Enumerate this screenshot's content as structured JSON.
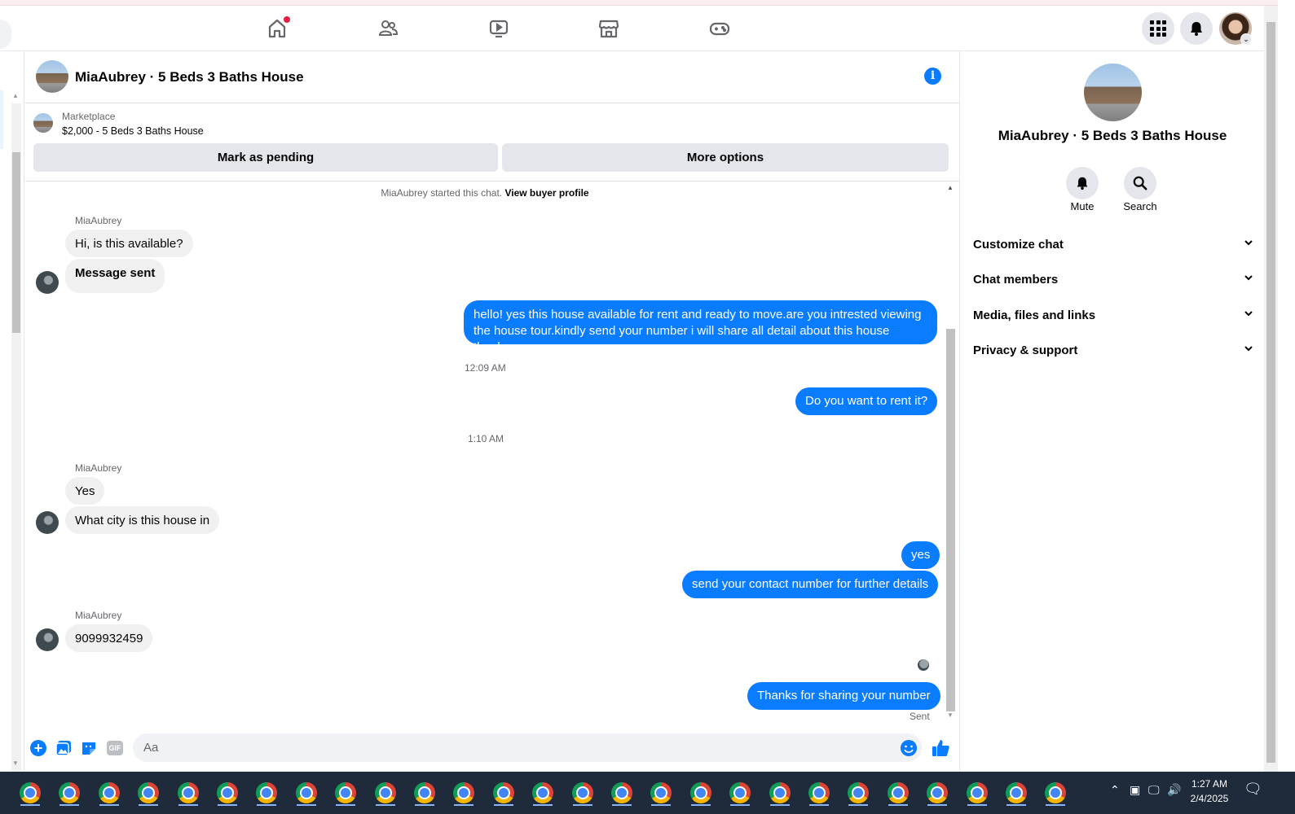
{
  "chat": {
    "title": "MiaAubrey · 5 Beds 3 Baths House"
  },
  "marketplace": {
    "label": "Marketplace",
    "listing": "$2,000 - 5 Beds 3 Baths House",
    "mark_pending": "Mark as pending",
    "more_options": "More options"
  },
  "messages": {
    "started_prefix": "MiaAubrey started this chat. ",
    "view_profile": "View buyer profile",
    "sender": "MiaAubrey",
    "in1": "Hi, is this available?",
    "in2": "Message sent",
    "out1_line1": "hello! yes this house available for rent and ready to move.are you intrested viewing",
    "out1_line2": "the house tour.kindly send your number i will share all detail about this house thanks.",
    "ts1": "12:09 AM",
    "out2": "Do you want to rent it?",
    "ts2": "1:10 AM",
    "in3": "Yes",
    "in4": "What city is this house in",
    "out3": "yes",
    "out4": "send your contact number for further details",
    "in5": "9099932459",
    "out5": "Thanks for sharing your number",
    "status": "Sent"
  },
  "composer": {
    "placeholder": "Aa"
  },
  "right_panel": {
    "title": "MiaAubrey · 5 Beds 3 Baths House",
    "mute": "Mute",
    "search": "Search",
    "sections": [
      "Customize chat",
      "Chat members",
      "Media, files and links",
      "Privacy & support"
    ]
  },
  "taskbar": {
    "time": "1:27 AM",
    "date": "2/4/2025"
  },
  "colors": {
    "accent": "#0a7cff",
    "notification_dot": "#e41e3f"
  }
}
